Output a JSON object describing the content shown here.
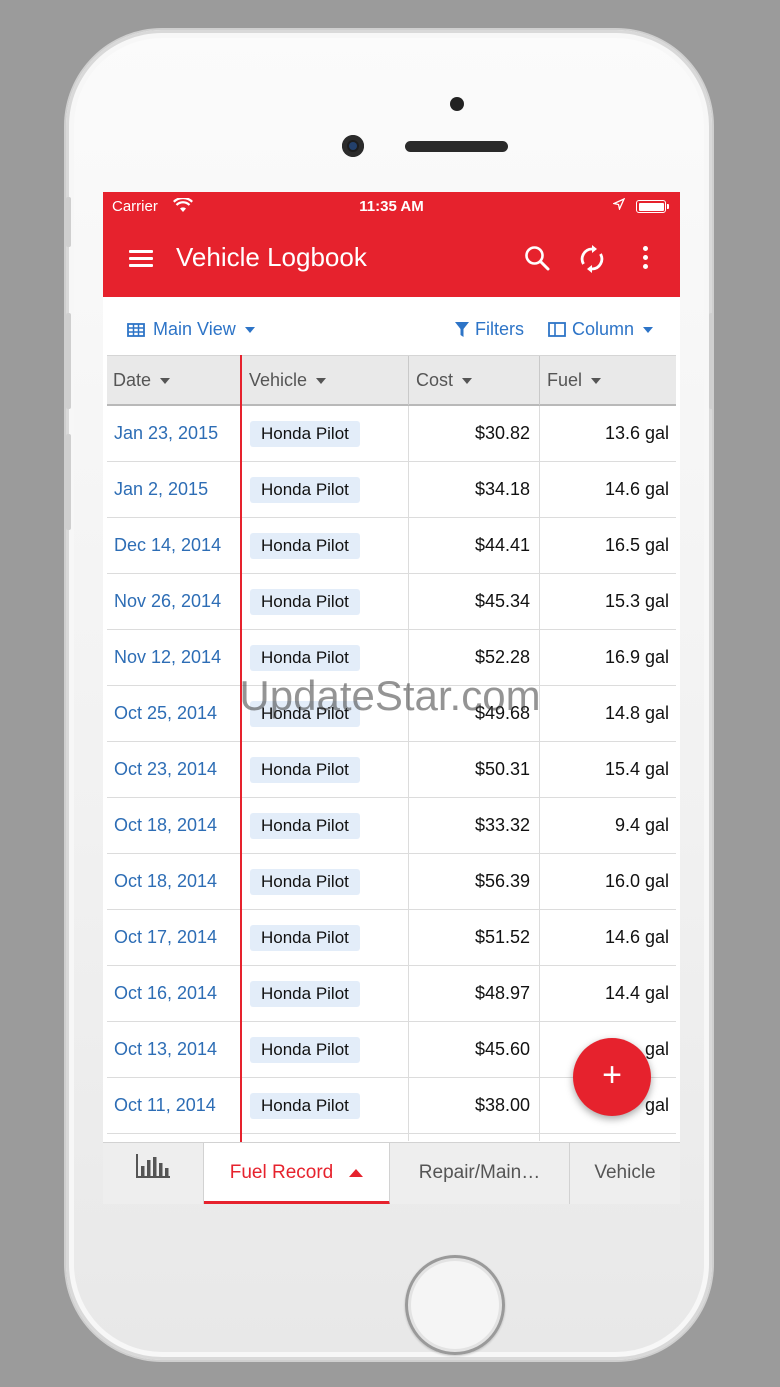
{
  "status": {
    "carrier": "Carrier",
    "time": "11:35 AM"
  },
  "appbar": {
    "title": "Vehicle Logbook"
  },
  "toolbar": {
    "view": "Main View",
    "filters": "Filters",
    "column": "Column"
  },
  "columns": {
    "date": "Date",
    "vehicle": "Vehicle",
    "cost": "Cost",
    "fuel": "Fuel"
  },
  "rows": [
    {
      "date": "Jan 23, 2015",
      "vehicle": "Honda Pilot",
      "cost": "$30.82",
      "fuel": "13.6 gal"
    },
    {
      "date": "Jan 2, 2015",
      "vehicle": "Honda Pilot",
      "cost": "$34.18",
      "fuel": "14.6 gal"
    },
    {
      "date": "Dec 14, 2014",
      "vehicle": "Honda Pilot",
      "cost": "$44.41",
      "fuel": "16.5 gal"
    },
    {
      "date": "Nov 26, 2014",
      "vehicle": "Honda Pilot",
      "cost": "$45.34",
      "fuel": "15.3 gal"
    },
    {
      "date": "Nov 12, 2014",
      "vehicle": "Honda Pilot",
      "cost": "$52.28",
      "fuel": "16.9 gal"
    },
    {
      "date": "Oct 25, 2014",
      "vehicle": "Honda Pilot",
      "cost": "$49.68",
      "fuel": "14.8 gal"
    },
    {
      "date": "Oct 23, 2014",
      "vehicle": "Honda Pilot",
      "cost": "$50.31",
      "fuel": "15.4 gal"
    },
    {
      "date": "Oct 18, 2014",
      "vehicle": "Honda Pilot",
      "cost": "$33.32",
      "fuel": "9.4 gal"
    },
    {
      "date": "Oct 18, 2014",
      "vehicle": "Honda Pilot",
      "cost": "$56.39",
      "fuel": "16.0 gal"
    },
    {
      "date": "Oct 17, 2014",
      "vehicle": "Honda Pilot",
      "cost": "$51.52",
      "fuel": "14.6 gal"
    },
    {
      "date": "Oct 16, 2014",
      "vehicle": "Honda Pilot",
      "cost": "$48.97",
      "fuel": "14.4 gal"
    },
    {
      "date": "Oct 13, 2014",
      "vehicle": "Honda Pilot",
      "cost": "$45.60",
      "fuel": "gal"
    },
    {
      "date": "Oct 11, 2014",
      "vehicle": "Honda Pilot",
      "cost": "$38.00",
      "fuel": "gal"
    }
  ],
  "fab": {
    "label": "+"
  },
  "tabs": {
    "chart_icon": "bar-chart-icon",
    "fuel": "Fuel Record",
    "repair": "Repair/Main…",
    "vehicle": "Vehicle"
  },
  "watermark": "UpdateStar.com",
  "colors": {
    "accent": "#e6222d",
    "link": "#2d6db5",
    "chip": "#e3edf9"
  }
}
